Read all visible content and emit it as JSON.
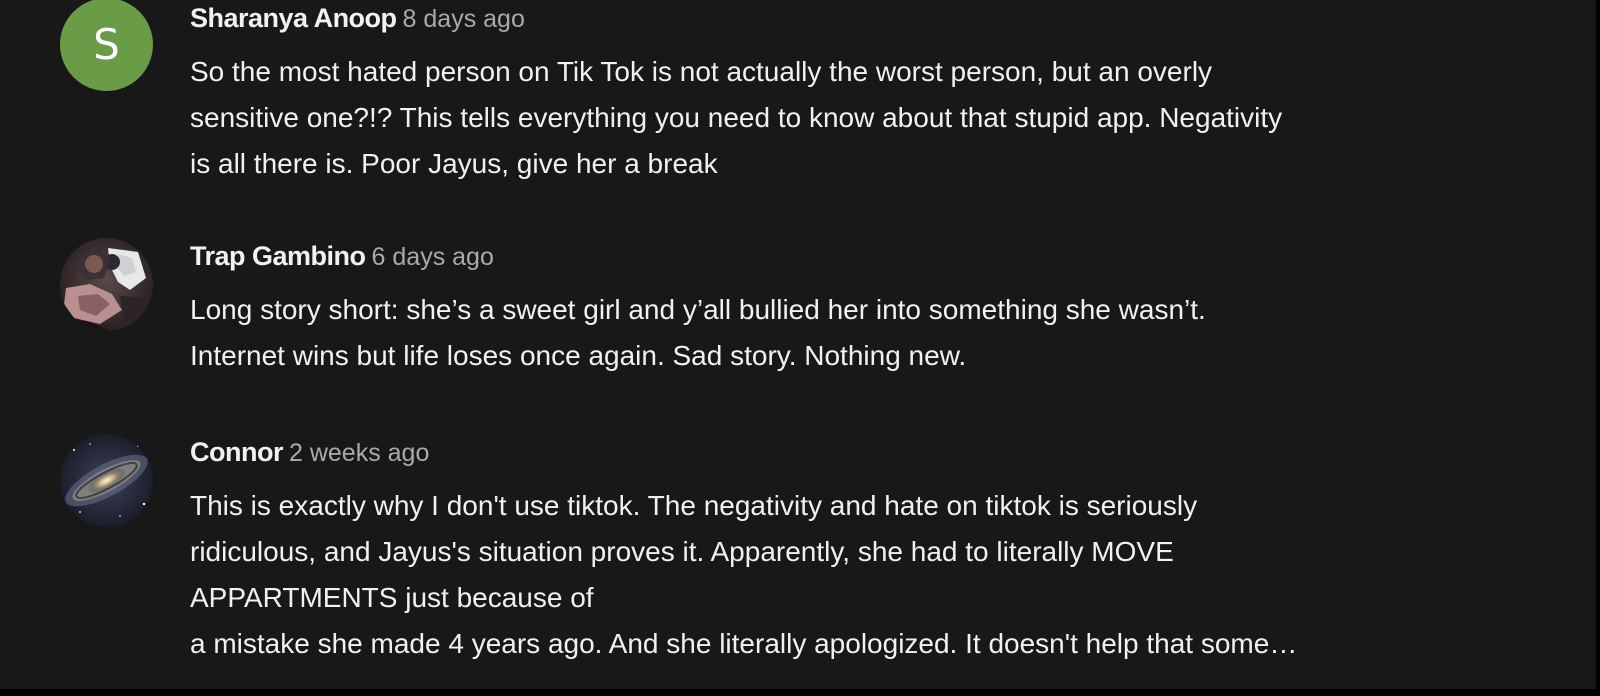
{
  "comments": [
    {
      "author": "Sharanya Anoop",
      "time": "8 days ago",
      "avatar_letter": "S",
      "avatar_color": "#6a9c48",
      "lines": [
        "So the most hated person on Tik Tok is not actually the worst person, but an overly",
        "sensitive one?!? This tells everything you need to know about that stupid app. Negativity",
        "is all there is. Poor Jayus, give her a break"
      ]
    },
    {
      "author": "Trap Gambino",
      "time": "6 days ago",
      "avatar_icon": "user-photo-avatar",
      "lines": [
        "Long story short: she’s a sweet girl and y’all bullied her into something she wasn’t.",
        "Internet wins but life loses once again. Sad story. Nothing new."
      ]
    },
    {
      "author": "Connor",
      "time": "2 weeks ago",
      "avatar_icon": "galaxy-avatar",
      "lines": [
        "This is exactly why I don't use tiktok. The negativity and hate on tiktok is seriously",
        "ridiculous, and Jayus's situation proves it. Apparently, she had to literally MOVE",
        "APPARTMENTS just because of",
        "a mistake she made 4 years ago. And she literally apologized. It doesn't help that some…"
      ]
    }
  ],
  "colors": {
    "background": "#181818",
    "text": "#f1f1f1",
    "timestamp": "#aaaaaa"
  }
}
